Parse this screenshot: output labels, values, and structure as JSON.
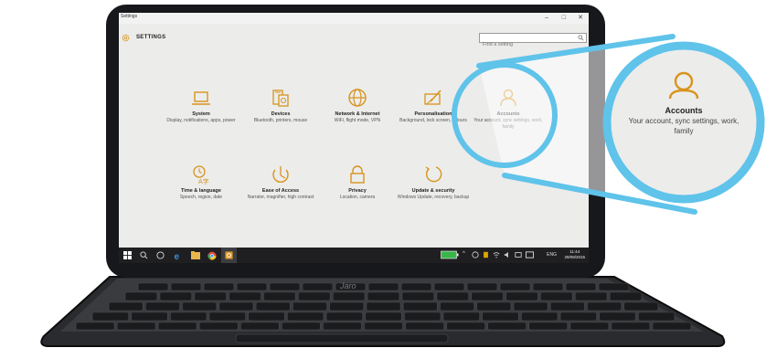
{
  "window": {
    "app_title": "Settings",
    "minimize_glyph": "–",
    "maximize_glyph": "□",
    "close_glyph": "✕"
  },
  "header": {
    "title": "SETTINGS",
    "search_placeholder": "Find a setting"
  },
  "tiles": [
    {
      "name": "System",
      "desc": "Display, notifications, apps, power",
      "icon": "laptop-icon"
    },
    {
      "name": "Devices",
      "desc": "Bluetooth, printers, mouse",
      "icon": "devices-icon"
    },
    {
      "name": "Network & Internet",
      "desc": "WiFi, flight mode, VPN",
      "icon": "globe-icon"
    },
    {
      "name": "Personalisation",
      "desc": "Background, lock screen, colours",
      "icon": "personalisation-icon"
    },
    {
      "name": "Accounts",
      "desc": "Your account, sync settings, work, family",
      "icon": "person-icon"
    },
    {
      "name": "Time & language",
      "desc": "Speech, region, date",
      "icon": "time-language-icon"
    },
    {
      "name": "Ease of Access",
      "desc": "Narrator, magnifier, high contrast",
      "icon": "ease-of-access-icon"
    },
    {
      "name": "Privacy",
      "desc": "Location, camera",
      "icon": "lock-icon"
    },
    {
      "name": "Update & security",
      "desc": "Windows Update, recovery, backup",
      "icon": "refresh-icon"
    }
  ],
  "taskbar": {
    "lang": "ENG",
    "time": "11:44",
    "date": "29/09/2015"
  },
  "laptop": {
    "brand": "Jaro"
  },
  "callout": {
    "title": "Accounts",
    "desc": "Your account, sync settings, work, family"
  },
  "colors": {
    "accent": "#d8941c",
    "highlight_ring": "#5fc3ea",
    "screen_bg": "#ececeb",
    "bezel": "#17181b"
  }
}
